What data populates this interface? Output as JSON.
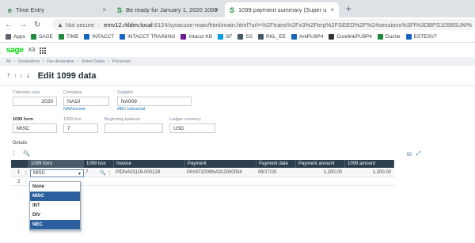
{
  "browser": {
    "tabs": [
      {
        "favicon": "e",
        "title": "Time Entry",
        "close": "×"
      },
      {
        "favicon": "S",
        "title": "Be ready for January 1, 2020 1099",
        "close": "×"
      },
      {
        "favicon": "S",
        "title": "1099 payment summary (Super u",
        "close": "×"
      }
    ],
    "new_tab": "+",
    "nav": {
      "back": "←",
      "forward": "→",
      "reload": "↻"
    },
    "address": {
      "warning": "▲",
      "not_secure": "Not secure",
      "separator": "|",
      "host": "emv12.rkldev.local",
      "path": ":8124/syracuse-main/html/main.html?url=%2Ftrans%2Fx3%2Ferp%2FSEED%2F%24sessions%3Ff%3DBPS1099SUM%"
    },
    "bookmarks": [
      {
        "label": "Apps",
        "color": "#5f6368"
      },
      {
        "label": "SAGE",
        "color": "#1e8a3c"
      },
      {
        "label": "TIME",
        "color": "#1e8a3c"
      },
      {
        "label": "INTACCT",
        "color": "#1565c0"
      },
      {
        "label": "INTACCT TRAINING",
        "color": "#1565c0"
      },
      {
        "label": "Intacct KB",
        "color": "#6a1b9a"
      },
      {
        "label": "SF",
        "color": "#039be5"
      },
      {
        "label": "SS",
        "color": "#455a64"
      },
      {
        "label": "RKL_EE",
        "color": "#455a64"
      },
      {
        "label": "ArkPU9P4",
        "color": "#1565c0"
      },
      {
        "label": "CorelinkPU9P4",
        "color": "#333333"
      },
      {
        "label": "Duche",
        "color": "#1e8a3c"
      },
      {
        "label": "ESTESV7",
        "color": "#1565c0"
      }
    ]
  },
  "app": {
    "logo": "sage",
    "product": "X3",
    "breadcrumbs": [
      "All",
      "Declarations",
      "Fee declaration",
      "United States",
      "Processes"
    ],
    "crumb_sep": ">",
    "nav_arrows": "⇡ ↑ ↓ ⇣",
    "page_title": "Edit 1099 data"
  },
  "form": {
    "calendar_year": {
      "label": "Calendar year",
      "value": "2020"
    },
    "company": {
      "label": "Company",
      "value": "NA10",
      "sub": "NADiscrete"
    },
    "supplier": {
      "label": "Supplier",
      "value": "NA009",
      "sub": "ABC Industrial"
    },
    "form_1099": {
      "label": "1099 form",
      "value": "MISC"
    },
    "box_1099": {
      "label": "1099 box",
      "value": "7"
    },
    "beginning_balance": {
      "label": "Beginning balance",
      "value": ""
    },
    "ledger_currency": {
      "label": "Ledger currency",
      "value": "USD"
    }
  },
  "details": {
    "label": "Details",
    "tools_left": [
      "⋮",
      "🔍"
    ],
    "tools_right": [
      "⛁",
      "⤢"
    ],
    "columns": [
      "1099 form",
      "1099 box",
      "Invoice",
      "Payment",
      "Payment date",
      "Payment amount",
      "1099 amount"
    ],
    "rows": [
      {
        "num": "1",
        "menu": "⋮",
        "form": "MISC",
        "box": "7",
        "invoice": "PIDNA01119-000128",
        "payment": "PAYAT2009NA012000004",
        "date": "09/17/20",
        "payment_amount": "1,200.00",
        "amount_1099": "1,200.00"
      },
      {
        "num": "2",
        "menu": "⋮"
      }
    ],
    "row_icons": "🔍 ⋮",
    "dropdown": {
      "caret": "▾",
      "options": [
        "None",
        "MISC",
        "INT",
        "DIV",
        "NEC"
      ],
      "highlighted": [
        "MISC",
        "NEC"
      ]
    }
  },
  "colors": {
    "header_bg": "#2d3e4f",
    "accent": "#2b5f9e",
    "sage_green": "#00dc00"
  }
}
